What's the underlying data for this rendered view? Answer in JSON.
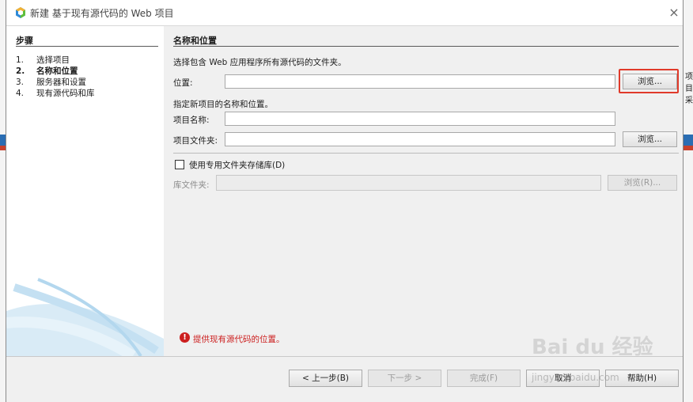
{
  "window": {
    "title": "新建 基于现有源代码的 Web 项目",
    "close_icon": "×"
  },
  "steps": {
    "header": "步骤",
    "items": [
      {
        "num": "1.",
        "label": "选择项目",
        "active": false
      },
      {
        "num": "2.",
        "label": "名称和位置",
        "active": true
      },
      {
        "num": "3.",
        "label": "服务器和设置",
        "active": false
      },
      {
        "num": "4.",
        "label": "现有源代码和库",
        "active": false
      }
    ]
  },
  "main": {
    "section_title": "名称和位置",
    "source_hint": "选择包含 Web 应用程序所有源代码的文件夹。",
    "location_label": "位置:",
    "location_value": "",
    "browse_label": "浏览...",
    "project_hint": "指定新项目的名称和位置。",
    "project_name_label": "项目名称:",
    "project_name_value": "",
    "project_folder_label": "项目文件夹:",
    "project_folder_value": "",
    "browse2_label": "浏览...",
    "dedicated_folder_label": "使用专用文件夹存储库(D)",
    "dedicated_folder_checked": false,
    "library_folder_label": "库文件夹:",
    "library_folder_value": "",
    "browse3_label": "浏览(R)...",
    "error_icon": "!",
    "error_message": "提供现有源代码的位置。"
  },
  "footer": {
    "back_label": "< 上一步(B)",
    "next_label": "下一步 >",
    "finish_label": "完成(F)",
    "cancel_label": "取消",
    "help_label": "帮助(H)"
  },
  "watermark": {
    "brand": "Bai du 经验",
    "url": "jingyan.baidu.com"
  },
  "background": {
    "right_text": "项\n目\n采"
  },
  "colors": {
    "highlight": "#e03a2a",
    "error": "#cc1f1f"
  }
}
